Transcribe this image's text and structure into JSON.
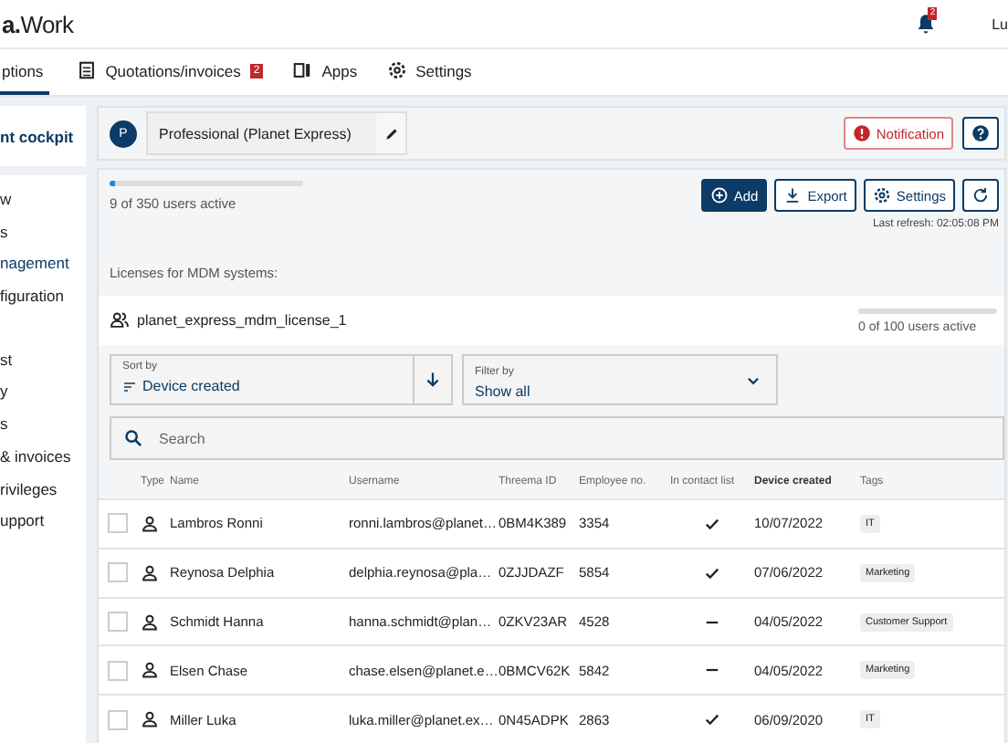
{
  "header": {
    "logo": "**a.**Work",
    "notification_count": "2",
    "user": "Lu"
  },
  "tabs": [
    {
      "label": "ptions",
      "selected": true
    },
    {
      "label": "Quotations/invoices",
      "selected": false,
      "badge": "2"
    },
    {
      "label": "Apps",
      "selected": false
    },
    {
      "label": "Settings",
      "selected": false
    }
  ],
  "sidebar": {
    "title": "nt cockpit",
    "groups": [
      [
        {
          "label": "w",
          "selected": false
        },
        {
          "label": "s",
          "selected": false
        },
        {
          "label": "nagement",
          "selected": true
        },
        {
          "label": "figuration",
          "selected": false
        }
      ],
      [
        {
          "label": "st",
          "selected": false
        },
        {
          "label": "y",
          "selected": false
        },
        {
          "label": "s",
          "selected": false
        },
        {
          "label": "& invoices",
          "selected": false
        },
        {
          "label": "rivileges",
          "selected": false
        },
        {
          "label": "upport",
          "selected": false
        }
      ]
    ]
  },
  "subscription": {
    "avatar": "P",
    "name": "Professional (Planet Express)",
    "buttons": [
      {
        "label": "Notification",
        "kind": "alert"
      },
      {
        "kind": "help"
      }
    ]
  },
  "users": {
    "level": 0.026,
    "reading": "9 of 350 users active",
    "buttons": [
      {
        "label": "Add",
        "kind": "primary"
      },
      {
        "label": "Export",
        "kind": "export"
      },
      {
        "label": "Settings",
        "kind": "settings"
      },
      {
        "kind": "refresh"
      }
    ],
    "last_refresh": "Last refresh: 02:05:08 PM"
  },
  "mdm": {
    "heading": "Licenses for MDM systems:",
    "licenses": [
      {
        "name": "planet_express_mdm_license_1",
        "level": 0,
        "reading": "0 of 100 users active"
      }
    ]
  },
  "sort": {
    "label": "Sort by",
    "value": "Device created"
  },
  "filter": {
    "label": "Filter by",
    "value": "Show all"
  },
  "search": {
    "placeholder": "Search"
  },
  "table": {
    "columns": [
      {
        "label": "Type",
        "sorted": false
      },
      {
        "label": "Name",
        "sorted": false
      },
      {
        "label": "Username",
        "sorted": false
      },
      {
        "label": "Threema ID",
        "sorted": false
      },
      {
        "label": "Employee no.",
        "sorted": false
      },
      {
        "label": "In contact list",
        "sorted": false
      },
      {
        "label": "Device created",
        "sorted": true
      },
      {
        "label": "Tags",
        "sorted": false
      }
    ],
    "rows": [
      {
        "checked": false,
        "name": "Lambros Ronni",
        "username": "ronni.lambros@planet…",
        "threema_id": "0BM4K389",
        "employee_no": "3354",
        "in_contact_list": true,
        "device_created": "10/07/2022",
        "tags": [
          "IT"
        ]
      },
      {
        "checked": false,
        "name": "Reynosa Delphia",
        "username": "delphia.reynosa@pla…",
        "threema_id": "0ZJJDAZF",
        "employee_no": "5854",
        "in_contact_list": true,
        "device_created": "07/06/2022",
        "tags": [
          "Marketing"
        ]
      },
      {
        "checked": false,
        "name": "Schmidt Hanna",
        "username": "hanna.schmidt@plan…",
        "threema_id": "0ZKV23AR",
        "employee_no": "4528",
        "in_contact_list": false,
        "device_created": "04/05/2022",
        "tags": [
          "Customer Support"
        ]
      },
      {
        "checked": false,
        "name": "Elsen Chase",
        "username": "chase.elsen@planet.e…",
        "threema_id": "0BMCV62K",
        "employee_no": "5842",
        "in_contact_list": false,
        "device_created": "04/05/2022",
        "tags": [
          "Marketing"
        ]
      },
      {
        "checked": false,
        "name": "Miller Luka",
        "username": "luka.miller@planet.ex…",
        "threema_id": "0N45ADPK",
        "employee_no": "2863",
        "in_contact_list": true,
        "device_created": "06/09/2020",
        "tags": [
          "IT"
        ]
      }
    ]
  }
}
